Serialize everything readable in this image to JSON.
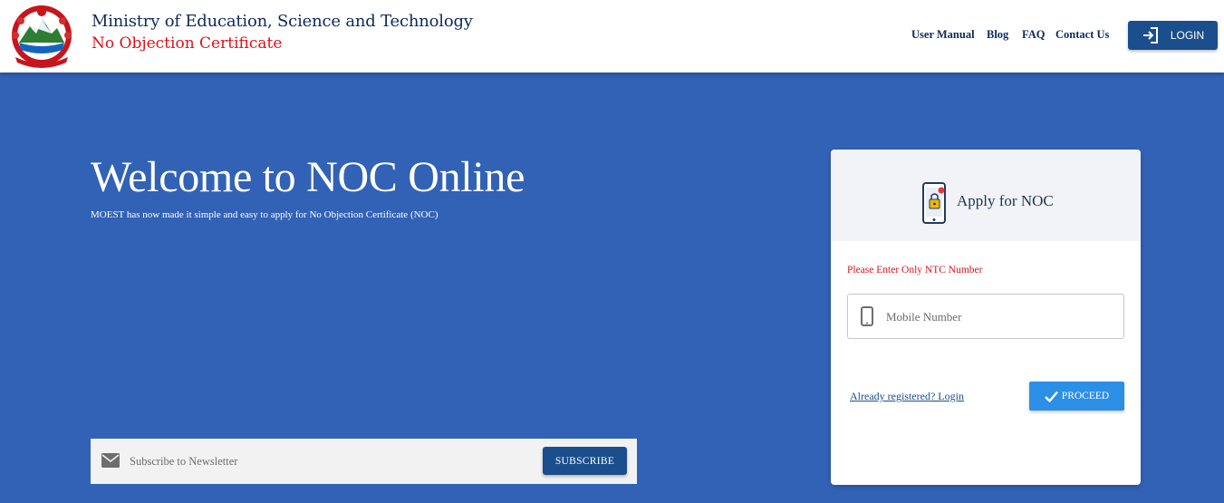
{
  "header": {
    "org_title": "Ministry of Education, Science and Technology",
    "org_subtitle": "No Objection Certificate",
    "nav": [
      "User Manual",
      "Blog",
      "FAQ",
      "Contact Us"
    ],
    "login_label": "LOGIN"
  },
  "hero": {
    "title": "Welcome to NOC Online",
    "subtitle": "MOEST has now made it simple and easy to apply for No Objection Certificate (NOC)"
  },
  "newsletter": {
    "placeholder": "Subscribe to Newsletter",
    "subscribe_label": "SUBSCRIBE"
  },
  "card": {
    "title": "Apply for NOC",
    "ntc_note": "Please Enter Only NTC Number",
    "mobile_placeholder": "Mobile Number",
    "already_link": "Already registered? Login",
    "proceed_label": "PROCEED"
  },
  "icons": {
    "logo": "nepal-emblem-logo",
    "login": "login-icon",
    "mail": "mail-icon",
    "apply": "phone-lock-icon",
    "mobile": "smartphone-icon",
    "proceed": "check-icon"
  },
  "colors": {
    "page_background": "#3262b6",
    "primary_button": "#1a4e8c",
    "proceed_button": "#2b8fe6",
    "subtitle_red": "#e0101a",
    "title_navy": "#0d2a5c"
  }
}
